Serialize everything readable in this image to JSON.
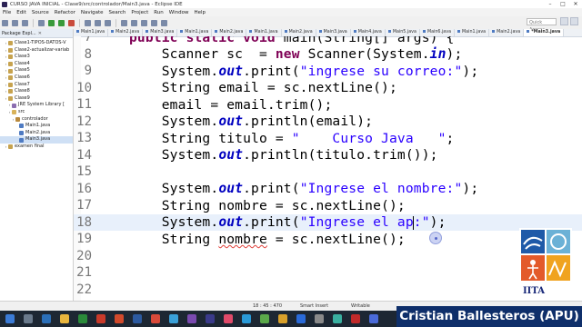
{
  "window": {
    "title": "CURSO JAVA INICIAL - Clase9/src/controlador/Main3.java - Eclipse IDE"
  },
  "menu": [
    "File",
    "Edit",
    "Source",
    "Refactor",
    "Navigate",
    "Search",
    "Project",
    "Run",
    "Window",
    "Help"
  ],
  "quick_access": {
    "placeholder": "Quick Access"
  },
  "explorer": {
    "title": "Package Expl...",
    "items": [
      {
        "label": "Clase1-TIPOS-DATOS-V",
        "indent": 1,
        "icon": "project-icon"
      },
      {
        "label": "Clase2-actualizar-variab",
        "indent": 1,
        "icon": "project-icon"
      },
      {
        "label": "Clase3",
        "indent": 1,
        "icon": "project-icon"
      },
      {
        "label": "Clase4",
        "indent": 1,
        "icon": "project-icon"
      },
      {
        "label": "Clase5",
        "indent": 1,
        "icon": "project-icon"
      },
      {
        "label": "Clase6",
        "indent": 1,
        "icon": "project-icon"
      },
      {
        "label": "Clase7",
        "indent": 1,
        "icon": "project-icon"
      },
      {
        "label": "Clase8",
        "indent": 1,
        "icon": "project-icon"
      },
      {
        "label": "Clase9",
        "indent": 1,
        "icon": "project-icon"
      },
      {
        "label": "JRE System Library [",
        "indent": 2,
        "icon": "library-icon"
      },
      {
        "label": "src",
        "indent": 2,
        "icon": "src-folder-icon"
      },
      {
        "label": "controlador",
        "indent": 3,
        "icon": "package-icon"
      },
      {
        "label": "Main1.java",
        "indent": 4,
        "icon": "java-file-icon"
      },
      {
        "label": "Main2.java",
        "indent": 4,
        "icon": "java-file-icon"
      },
      {
        "label": "Main3.java",
        "indent": 4,
        "icon": "java-file-icon",
        "selected": true
      },
      {
        "label": "examen final",
        "indent": 1,
        "icon": "project-icon"
      }
    ]
  },
  "tabs": [
    "Main1.java",
    "Main2.java",
    "Main3.java",
    "Main1.java",
    "Main2.java",
    "Main1.java",
    "Main2.java",
    "Main3.java",
    "Main4.java",
    "Main5.java",
    "Main6.java",
    "Main1.java",
    "Main2.java",
    "*Main3.java"
  ],
  "active_tab_index": 13,
  "editor": {
    "lines": [
      {
        "n": "7",
        "html": "public static void main(String[] args) {"
      },
      {
        "n": "8",
        "html": "    Scanner sc  = new Scanner(System.in);"
      },
      {
        "n": "9",
        "html": "    System.out.print(\"ingrese su correo:\");"
      },
      {
        "n": "10",
        "html": "    String email = sc.nextLine();"
      },
      {
        "n": "11",
        "html": "    email = email.trim();"
      },
      {
        "n": "12",
        "html": "    System.out.println(email);"
      },
      {
        "n": "13",
        "html": "    String titulo = \"    Curso Java   \";"
      },
      {
        "n": "14",
        "html": "    System.out.println(titulo.trim());"
      },
      {
        "n": "15",
        "html": ""
      },
      {
        "n": "16",
        "html": "    System.out.print(\"Ingrese el nombre:\");"
      },
      {
        "n": "17",
        "html": "    String nombre = sc.nextLine();"
      },
      {
        "n": "18",
        "html": "    System.out.print(\"Ingrese el ap:\");"
      },
      {
        "n": "19",
        "html": "    String nombre = sc.nextLine();"
      },
      {
        "n": "20",
        "html": ""
      },
      {
        "n": "21",
        "html": ""
      },
      {
        "n": "22",
        "html": ""
      }
    ],
    "current_line_index": 11
  },
  "status": {
    "mode": "Writable",
    "insert": "Smart Insert",
    "position": "18 : 45 : 470"
  },
  "logo_text": "IITA",
  "caption": "Cristian Ballesteros (APU)"
}
